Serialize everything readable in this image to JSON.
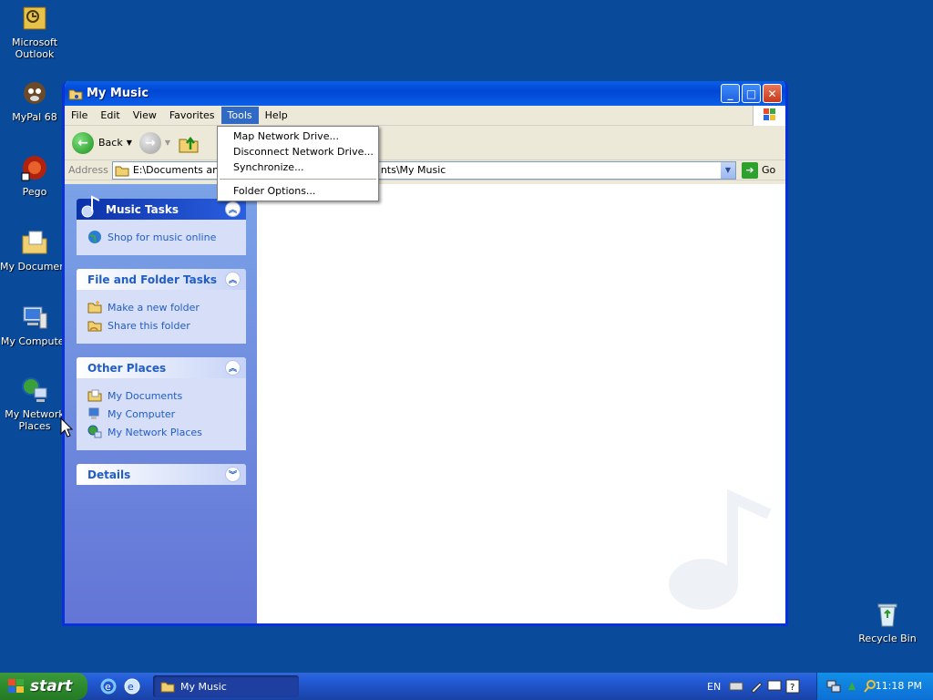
{
  "desktop": {
    "icons": [
      {
        "label": "Microsoft Outlook"
      },
      {
        "label": "MyPal 68"
      },
      {
        "label": "Pego"
      },
      {
        "label": "My Documents"
      },
      {
        "label": "My Computer"
      },
      {
        "label": "My Network Places"
      },
      {
        "label": "Recycle Bin"
      }
    ]
  },
  "window": {
    "title": "My Music",
    "menu": [
      "File",
      "Edit",
      "View",
      "Favorites",
      "Tools",
      "Help"
    ],
    "toolbar": {
      "back_label": "Back"
    },
    "address": {
      "label": "Address",
      "value": "E:\\Documents and Settings\\...\\My Documents\\My Music",
      "value_left": "E:\\Documents and S",
      "value_right": "nts\\My Music",
      "go_label": "Go"
    },
    "tools_menu": [
      "Map Network Drive...",
      "Disconnect Network Drive...",
      "Synchronize...",
      "Folder Options..."
    ]
  },
  "taskpane": {
    "music_tasks": {
      "title": "Music Tasks",
      "items": [
        "Shop for music online"
      ]
    },
    "file_folder_tasks": {
      "title": "File and Folder Tasks",
      "items": [
        "Make a new folder",
        "Share this folder"
      ]
    },
    "other_places": {
      "title": "Other Places",
      "items": [
        "My Documents",
        "My Computer",
        "My Network Places"
      ]
    },
    "details": {
      "title": "Details"
    }
  },
  "taskbar": {
    "start_label": "start",
    "task_label": "My Music",
    "language": "EN",
    "clock": "11:18 PM"
  },
  "colors": {
    "desktop": "#0a4a9b",
    "title_blue": "#0046d5",
    "link": "#215dc6",
    "start_green": "#2d8a2d"
  }
}
